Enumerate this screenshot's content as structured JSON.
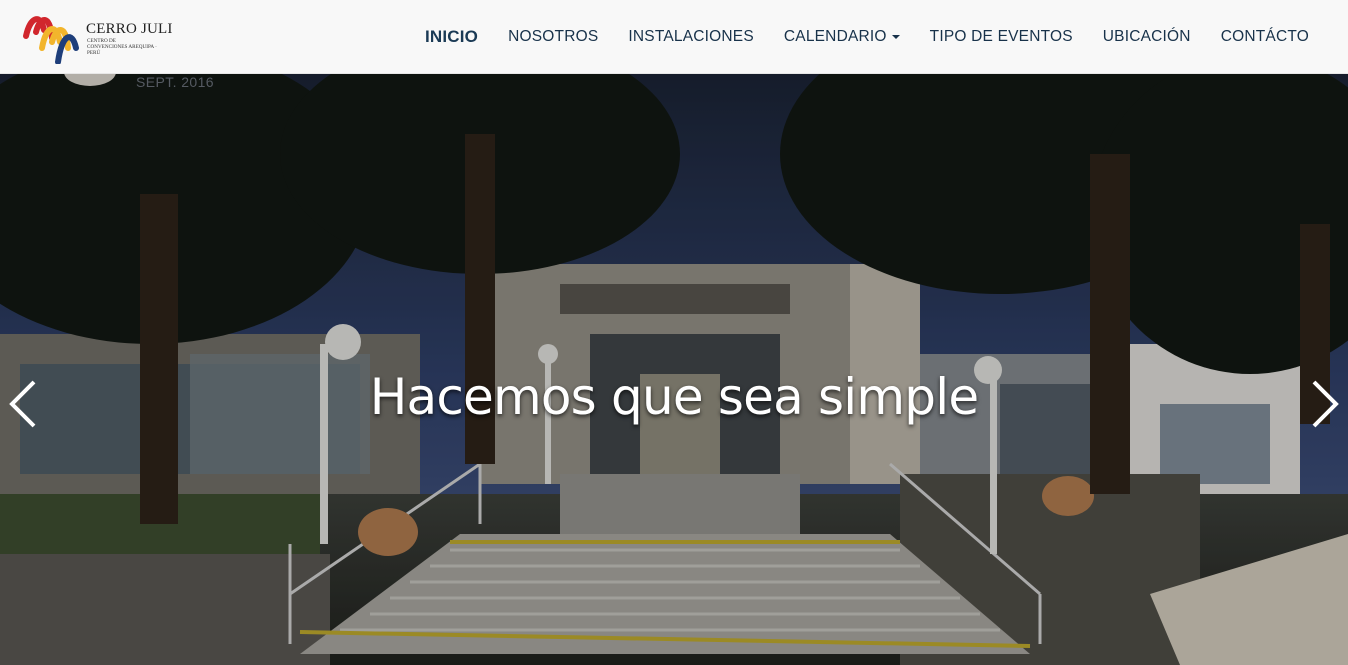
{
  "brand": {
    "name": "CERRO JULI",
    "subtitle": "Centro de Convenciones Arequipa · Perú",
    "colors": {
      "red": "#d1262d",
      "yellow": "#f2b52c",
      "blue": "#1e3e7a"
    }
  },
  "nav": {
    "items": [
      {
        "label": "INICIO",
        "active": true
      },
      {
        "label": "NOSOTROS"
      },
      {
        "label": "INSTALACIONES"
      },
      {
        "label": "CALENDARIO",
        "dropdown": true
      },
      {
        "label": "TIPO DE EVENTOS"
      },
      {
        "label": "UBICACIÓN"
      },
      {
        "label": "CONTÁCTO"
      }
    ]
  },
  "carousel": {
    "caption": "Hacemos que sea simple",
    "date_label": "SEPT. 2016",
    "prev_icon": "chevron-left-icon",
    "next_icon": "chevron-right-icon"
  }
}
